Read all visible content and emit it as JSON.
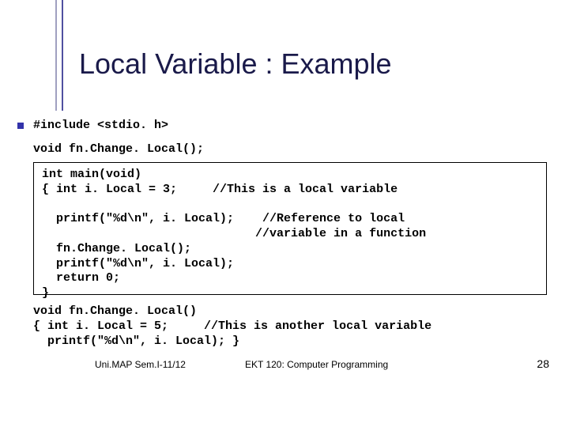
{
  "title": "Local Variable : Example",
  "code": {
    "include": "#include <stdio. h>",
    "proto": "void fn.Change. Local();",
    "main_box": "int main(void)\n{ int i. Local = 3;     //This is a local variable\n\n  printf(\"%d\\n\", i. Local);    //Reference to local\n                              //variable in a function\n  fn.Change. Local();\n  printf(\"%d\\n\", i. Local);\n  return 0;\n}",
    "func_block": "void fn.Change. Local()\n{ int i. Local = 5;     //This is another local variable\n  printf(\"%d\\n\", i. Local); }"
  },
  "footer": {
    "left": "Uni.MAP Sem.I-11/12",
    "center": "EKT 120: Computer Programming",
    "pagenum": "28"
  }
}
